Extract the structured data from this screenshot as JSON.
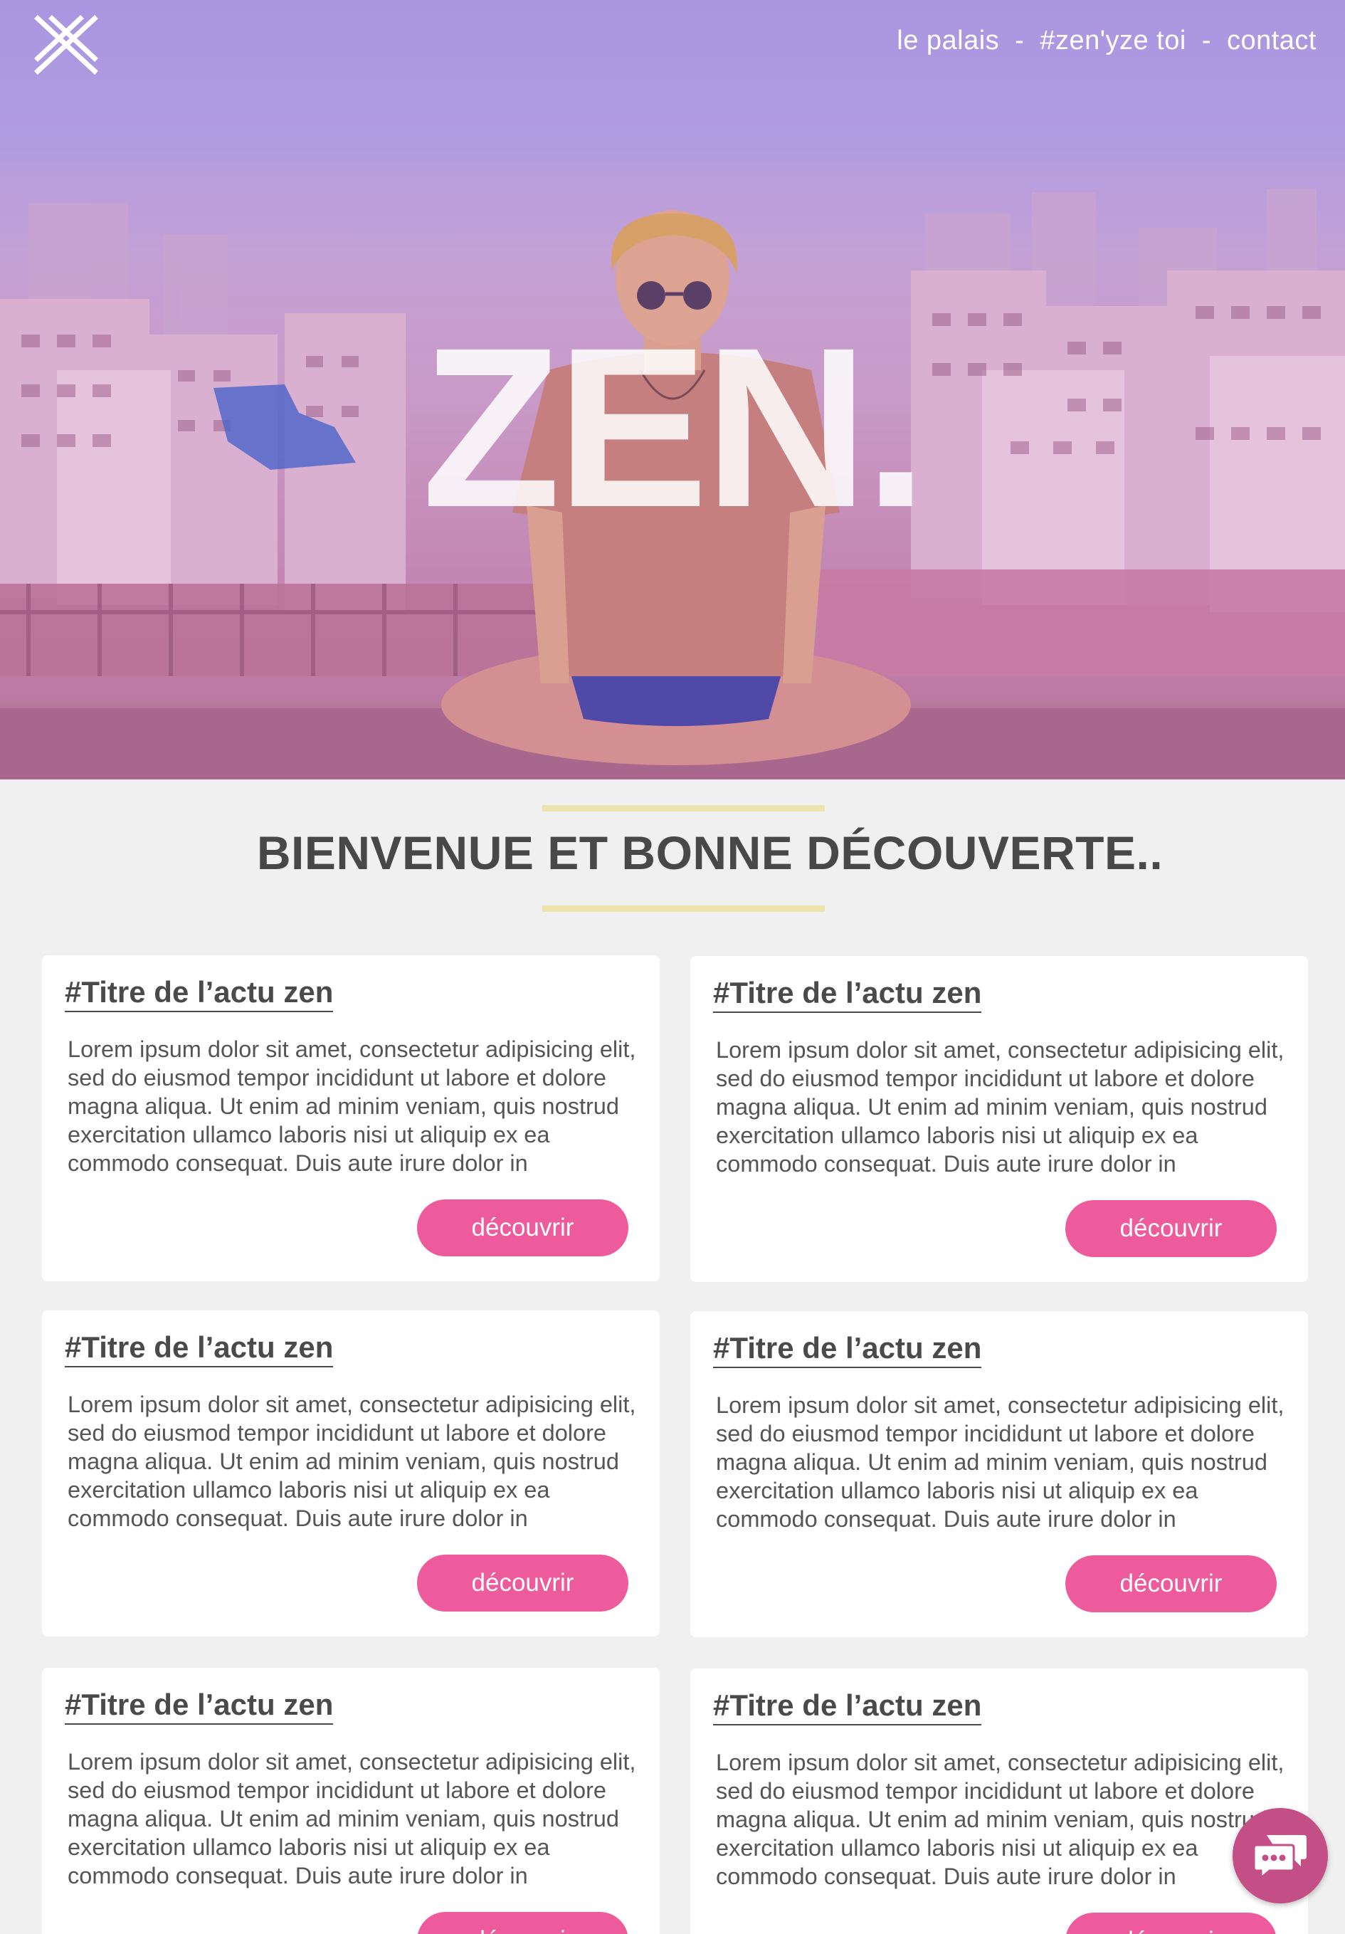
{
  "nav": {
    "items": [
      "le palais",
      "#zen'yze toi",
      "contact"
    ],
    "separator": "-"
  },
  "hero": {
    "title": "ZEN."
  },
  "welcome": {
    "heading": "BIENVENUE ET BONNE DÉCOUVERTE.."
  },
  "articles": [
    {
      "title": "#Titre de l’actu zen",
      "text": "Lorem ipsum dolor sit amet, consectetur adipisicing elit, sed do eiusmod tempor incididunt ut labore et dolore magna aliqua. Ut enim ad minim veniam, quis nostrud exercitation ullamco laboris nisi ut aliquip ex ea commodo consequat. Duis aute irure dolor in",
      "button": "découvrir"
    },
    {
      "title": "#Titre de l’actu zen",
      "text": "Lorem ipsum dolor sit amet, consectetur adipisicing elit, sed do eiusmod tempor incididunt ut labore et dolore magna aliqua. Ut enim ad minim veniam, quis nostrud exercitation ullamco laboris nisi ut aliquip ex ea commodo consequat. Duis aute irure dolor in",
      "button": "découvrir"
    },
    {
      "title": "#Titre de l’actu zen",
      "text": "Lorem ipsum dolor sit amet, consectetur adipisicing elit, sed do eiusmod tempor incididunt ut labore et dolore magna aliqua. Ut enim ad minim veniam, quis nostrud exercitation ullamco laboris nisi ut aliquip ex ea commodo consequat. Duis aute irure dolor in",
      "button": "découvrir"
    },
    {
      "title": "#Titre de l’actu zen",
      "text": "Lorem ipsum dolor sit amet, consectetur adipisicing elit, sed do eiusmod tempor incididunt ut labore et dolore magna aliqua. Ut enim ad minim veniam, quis nostrud exercitation ullamco laboris nisi ut aliquip ex ea commodo consequat. Duis aute irure dolor in",
      "button": "découvrir"
    },
    {
      "title": "#Titre de l’actu zen",
      "text": "Lorem ipsum dolor sit amet, consectetur adipisicing elit, sed do eiusmod tempor incididunt ut labore et dolore magna aliqua. Ut enim ad minim veniam, quis nostrud exercitation ullamco laboris nisi ut aliquip ex ea commodo consequat. Duis aute irure dolor in",
      "button": "découvrir"
    },
    {
      "title": "#Titre de l’actu zen",
      "text": "Lorem ipsum dolor sit amet, consectetur adipisicing elit, sed do eiusmod tempor incididunt ut labore et dolore magna aliqua. Ut enim ad minim veniam, quis nostrud exercitation ullamco laboris nisi ut aliquip ex ea commodo consequat. Duis aute irure dolor in",
      "button": "découvrir"
    }
  ],
  "colors": {
    "accent_pink": "#ee5b9c",
    "chat_button": "#c44f86",
    "rule_yellow": "#ede3ad",
    "page_background": "#f0f0f0",
    "hero_overlay": "#a896e0"
  },
  "icons": {
    "logo": "crossed-lines-logo-icon",
    "chat": "chat-bubbles-icon"
  }
}
